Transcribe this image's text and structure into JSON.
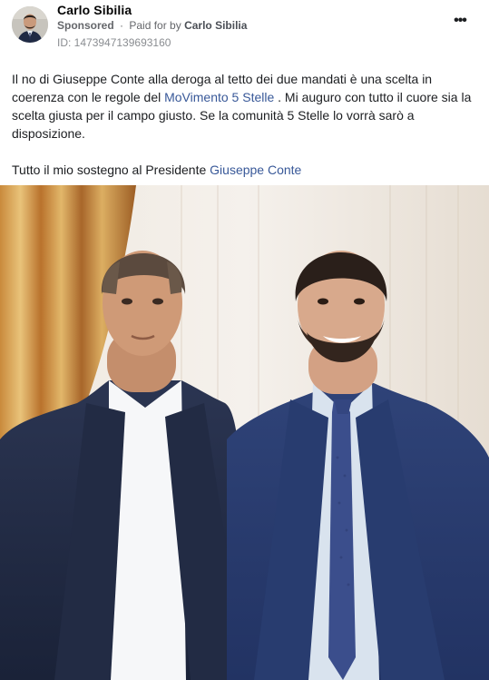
{
  "post": {
    "author": "Carlo Sibilia",
    "sponsored_label": "Sponsored",
    "separator": "·",
    "paid_prefix": "Paid for by",
    "paid_by": "Carlo Sibilia",
    "ad_id": "ID: 1473947139693160",
    "more_icon": "more-horizontal-icon",
    "more_glyph": "•••"
  },
  "message": {
    "p1_a": "Il no di Giuseppe Conte alla deroga al tetto dei due mandati è una scelta in coerenza con le regole del ",
    "p1_link": "MoVimento 5 Stelle",
    "p1_b": " . Mi auguro con tutto il cuore sia la scelta giusta per il campo giusto. Se la comunità 5 Stelle lo vorrà sarò a disposizione.",
    "p2_a": "Tutto il mio sostegno al Presidente ",
    "p2_link": "Giuseppe Conte"
  },
  "colors": {
    "link": "#385898",
    "meta": "#65676b"
  }
}
